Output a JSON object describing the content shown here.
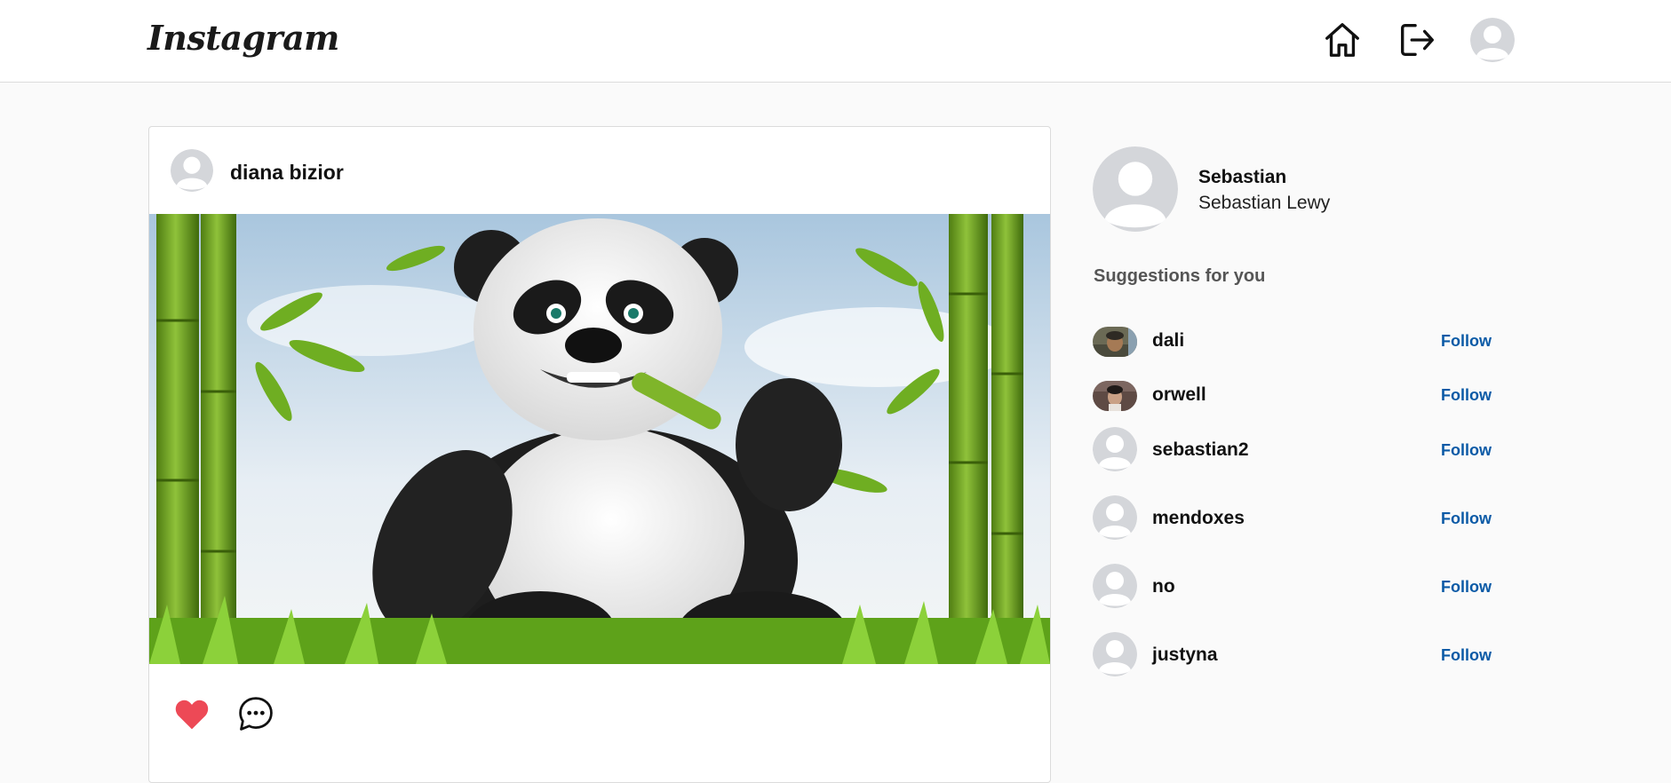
{
  "header": {
    "logo": "Instagram",
    "icons": [
      "home-icon",
      "logout-icon",
      "profile-avatar"
    ]
  },
  "post": {
    "username": "diana bizior",
    "image": "panda eating bamboo illustration",
    "liked": true,
    "like_color": "#ed4956"
  },
  "sidebar": {
    "username": "Sebastian",
    "full_name": "Sebastian Lewy",
    "suggestions_title": "Suggestions for you",
    "follow_label": "Follow",
    "follow_color": "#0b5aa6",
    "suggestions": [
      {
        "username": "dali",
        "avatar": "photo"
      },
      {
        "username": "orwell",
        "avatar": "photo"
      },
      {
        "username": "sebastian2",
        "avatar": "default"
      },
      {
        "username": "mendoxes",
        "avatar": "default"
      },
      {
        "username": "no",
        "avatar": "default"
      },
      {
        "username": "justyna",
        "avatar": "default"
      }
    ]
  }
}
